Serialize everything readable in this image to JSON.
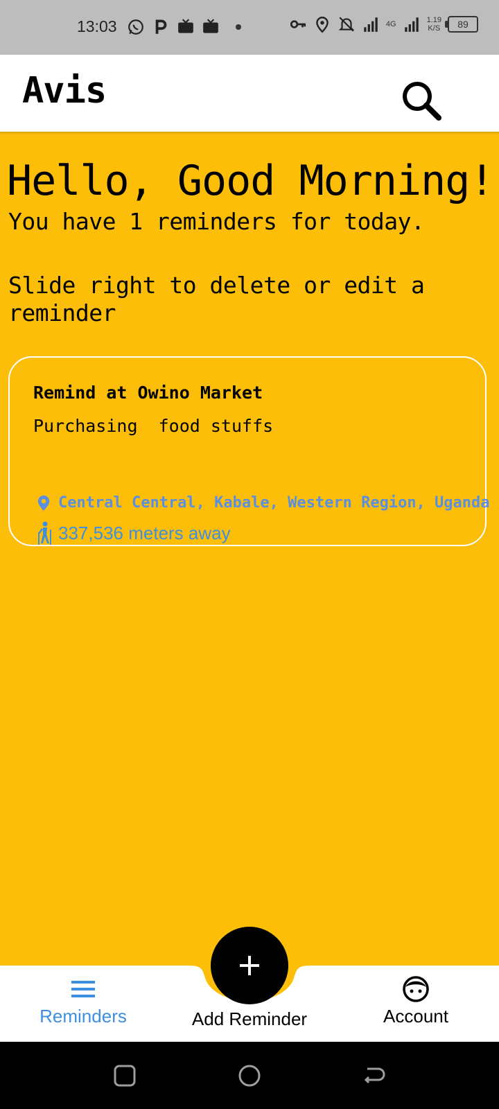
{
  "status_bar": {
    "time": "13:03",
    "network": "4G",
    "speed_value": "1.19",
    "speed_unit": "K/S",
    "battery": "89"
  },
  "app_bar": {
    "title": "Avis"
  },
  "greeting": {
    "title": "Hello, Good Morning!",
    "subtitle": "You have 1 reminders for today.",
    "hint": "Slide right to delete or edit a reminder"
  },
  "reminders": [
    {
      "title": "Remind at Owino Market",
      "description": "Purchasing  food stuffs",
      "location": "Central Central, Kabale, Western Region, Uganda",
      "distance": "337,536 meters away"
    }
  ],
  "bottom_nav": {
    "items": [
      {
        "label": "Reminders",
        "icon": "menu-icon",
        "active": true
      },
      {
        "label": "Add Reminder",
        "icon": "plus-icon",
        "active": false
      },
      {
        "label": "Account",
        "icon": "account-face-icon",
        "active": false
      }
    ]
  },
  "colors": {
    "background": "#FCBE08",
    "accent": "#3D8FE0",
    "location_text": "#5B8FE0"
  }
}
